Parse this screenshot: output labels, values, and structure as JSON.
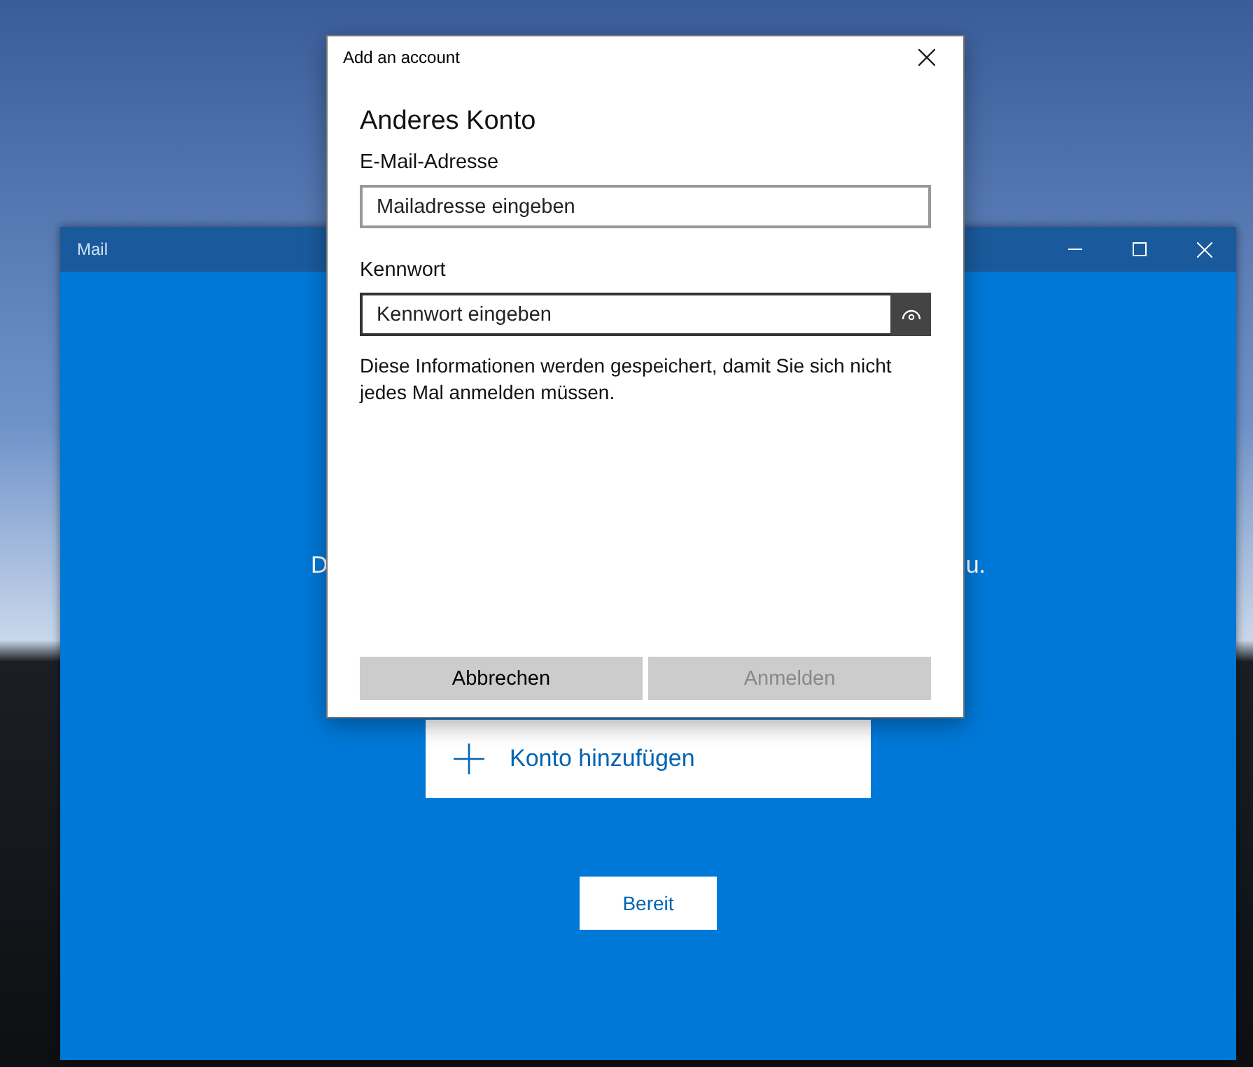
{
  "mail_window": {
    "title": "Mail",
    "body_text_left": "D",
    "body_text_right": "u.",
    "add_account_button": {
      "label": "Konto hinzufügen"
    },
    "ready_button": {
      "label": "Bereit"
    }
  },
  "dialog": {
    "title": "Add an account",
    "heading": "Anderes Konto",
    "fields": [
      {
        "label": "E-Mail-Adresse",
        "placeholder": "Mailadresse eingeben",
        "kind": "text",
        "focused": false
      },
      {
        "label": "Kennwort",
        "placeholder": "Kennwort eingeben",
        "kind": "password",
        "focused": true
      }
    ],
    "info": "Diese Informationen werden gespeichert, damit Sie sich nicht jedes Mal anmelden müssen.",
    "buttons": [
      {
        "label": "Abbrechen",
        "disabled": false
      },
      {
        "label": "Anmelden",
        "disabled": true
      }
    ]
  }
}
